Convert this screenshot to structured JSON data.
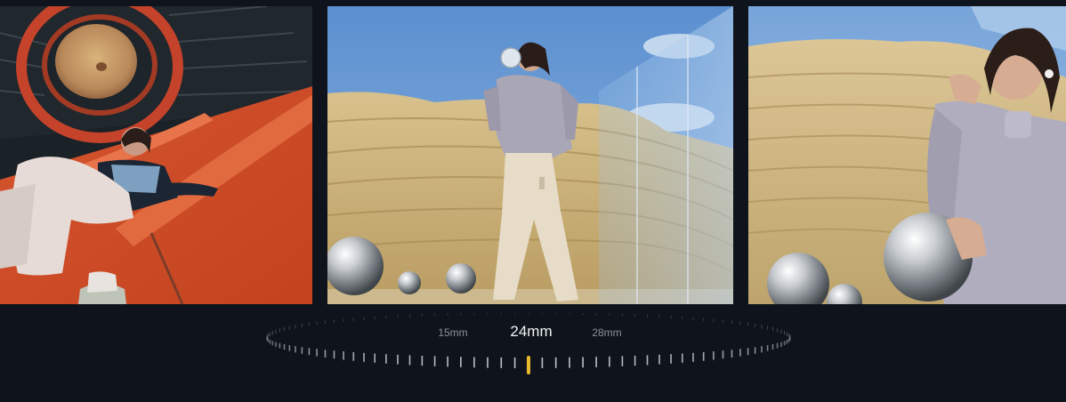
{
  "gallery": {
    "photos": [
      {
        "icon": "red-spiral-staircase-photo"
      },
      {
        "icon": "sandstone-wall-photo"
      },
      {
        "icon": "closeup-sandstone-photo"
      }
    ]
  },
  "lens_dial": {
    "options": [
      {
        "label": "15mm"
      },
      {
        "label": "24mm"
      },
      {
        "label": "28mm"
      }
    ],
    "selected": "24mm",
    "colors": {
      "indicator": "#e8b92a",
      "tick": "#c9ccd1",
      "active_text": "#f1f3f5",
      "inactive_text": "#8b919a",
      "background": "#0f141c"
    }
  }
}
